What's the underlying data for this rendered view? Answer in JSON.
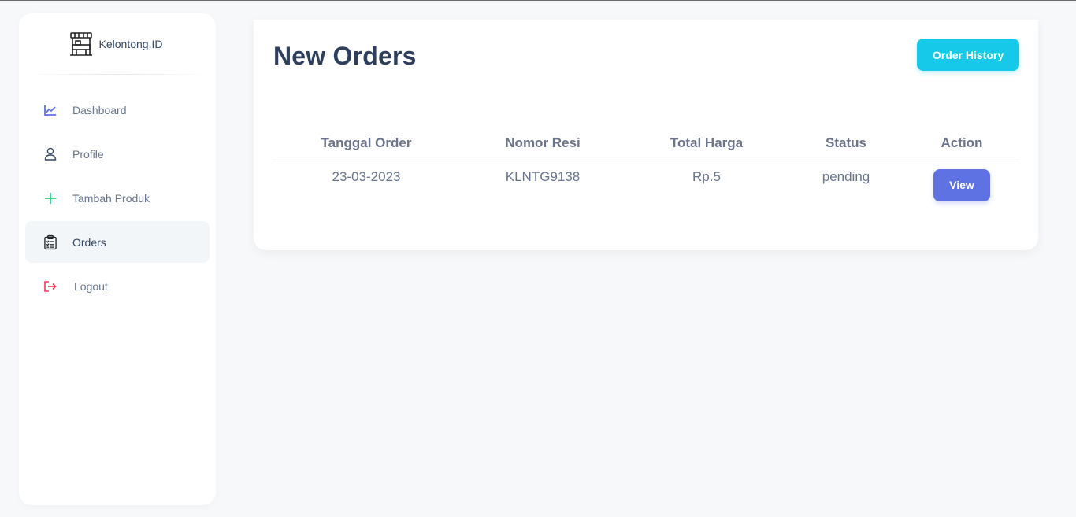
{
  "sidebar": {
    "brand_name": "Kelontong.ID",
    "items": [
      {
        "label": "Dashboard",
        "icon": "chart-line-icon",
        "color": "#5e72e4"
      },
      {
        "label": "Profile",
        "icon": "user-icon",
        "color": "#344767"
      },
      {
        "label": "Tambah Produk",
        "icon": "plus-icon",
        "color": "#2dce89"
      },
      {
        "label": "Orders",
        "icon": "clipboard-list-icon",
        "color": "#344767",
        "active": true
      },
      {
        "label": "Logout",
        "icon": "logout-icon",
        "color": "#f5365c"
      }
    ]
  },
  "main": {
    "title": "New Orders",
    "order_history_label": "Order History",
    "table": {
      "headers": [
        "Tanggal Order",
        "Nomor Resi",
        "Total Harga",
        "Status",
        "Action"
      ],
      "rows": [
        {
          "tanggal": "23-03-2023",
          "resi": "KLNTG9138",
          "harga": "Rp.5",
          "status": "pending",
          "action": "View"
        }
      ]
    }
  },
  "colors": {
    "accent_cyan": "#17c9e8",
    "accent_indigo": "#5e72e4",
    "background": "#f7f8fa"
  }
}
